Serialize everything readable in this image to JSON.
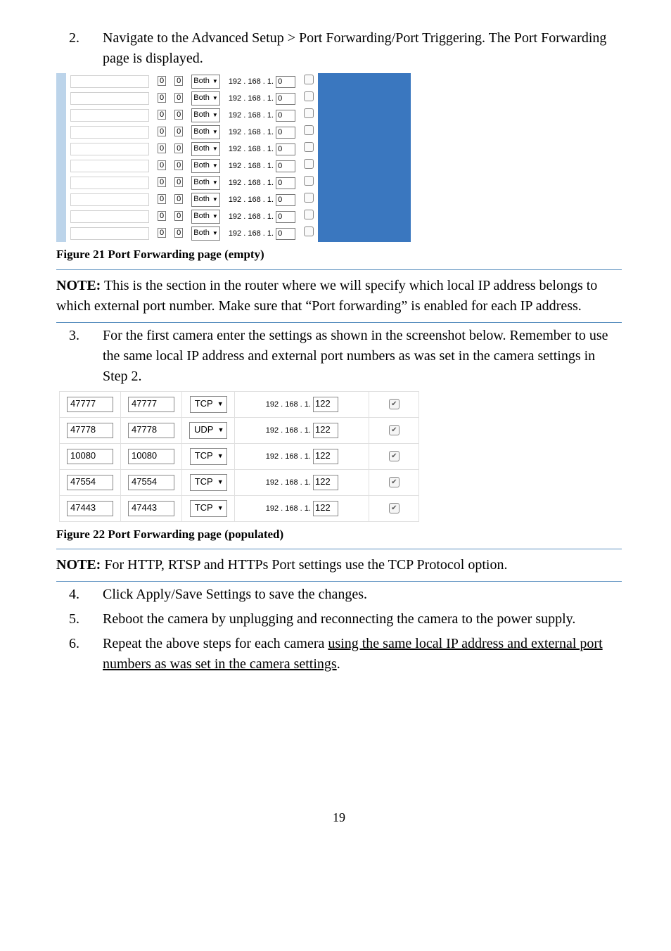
{
  "step2": {
    "num": "2.",
    "text": "Navigate to the Advanced Setup > Port Forwarding/Port Triggering. The Port Forwarding page is displayed."
  },
  "fig21": {
    "caption": "Figure 21 Port Forwarding page (empty)",
    "rows": [
      {
        "a": "0",
        "b": "0",
        "proto": "Both",
        "ip_prefix": "192 . 168 . 1.",
        "ip_last": "0"
      },
      {
        "a": "0",
        "b": "0",
        "proto": "Both",
        "ip_prefix": "192 . 168 . 1.",
        "ip_last": "0"
      },
      {
        "a": "0",
        "b": "0",
        "proto": "Both",
        "ip_prefix": "192 . 168 . 1.",
        "ip_last": "0"
      },
      {
        "a": "0",
        "b": "0",
        "proto": "Both",
        "ip_prefix": "192 . 168 . 1.",
        "ip_last": "0"
      },
      {
        "a": "0",
        "b": "0",
        "proto": "Both",
        "ip_prefix": "192 . 168 . 1.",
        "ip_last": "0"
      },
      {
        "a": "0",
        "b": "0",
        "proto": "Both",
        "ip_prefix": "192 . 168 . 1.",
        "ip_last": "0"
      },
      {
        "a": "0",
        "b": "0",
        "proto": "Both",
        "ip_prefix": "192 . 168 . 1.",
        "ip_last": "0"
      },
      {
        "a": "0",
        "b": "0",
        "proto": "Both",
        "ip_prefix": "192 . 168 . 1.",
        "ip_last": "0"
      },
      {
        "a": "0",
        "b": "0",
        "proto": "Both",
        "ip_prefix": "192 . 168 . 1.",
        "ip_last": "0"
      },
      {
        "a": "0",
        "b": "0",
        "proto": "Both",
        "ip_prefix": "192 . 168 . 1.",
        "ip_last": "0"
      }
    ]
  },
  "note1": {
    "label": "NOTE:",
    "text": " This is the section in the router where we will specify which local IP address belongs to which external port number. Make sure that “Port forwarding” is enabled for each IP address."
  },
  "step3": {
    "num": "3.",
    "text": "For the first camera enter the settings as shown in the screenshot below. Remember to use the same local IP address and external port numbers as was set in the camera settings in Step 2."
  },
  "fig22": {
    "caption": "Figure 22 Port Forwarding page (populated)",
    "rows": [
      {
        "a": "47777",
        "b": "47777",
        "proto": "TCP",
        "ip_prefix": "192 . 168 . 1.",
        "ip_last": "122"
      },
      {
        "a": "47778",
        "b": "47778",
        "proto": "UDP",
        "ip_prefix": "192 . 168 . 1.",
        "ip_last": "122"
      },
      {
        "a": "10080",
        "b": "10080",
        "proto": "TCP",
        "ip_prefix": "192 . 168 . 1.",
        "ip_last": "122"
      },
      {
        "a": "47554",
        "b": "47554",
        "proto": "TCP",
        "ip_prefix": "192 . 168 . 1.",
        "ip_last": "122"
      },
      {
        "a": "47443",
        "b": "47443",
        "proto": "TCP",
        "ip_prefix": "192 . 168 . 1.",
        "ip_last": "122"
      }
    ]
  },
  "note2": {
    "label": "NOTE:",
    "text": " For HTTP, RTSP and HTTPs Port settings use the TCP Protocol option."
  },
  "step4": {
    "num": "4.",
    "text": "Click Apply/Save Settings to save the changes."
  },
  "step5": {
    "num": "5.",
    "text": "Reboot the camera by unplugging and reconnecting the camera to the power supply."
  },
  "step6": {
    "num": "6.",
    "text_before": "Repeat the above steps for each camera ",
    "text_underlined": "using the same local IP address and external port numbers as was set in the camera settings",
    "text_after": "."
  },
  "page_number": "19"
}
